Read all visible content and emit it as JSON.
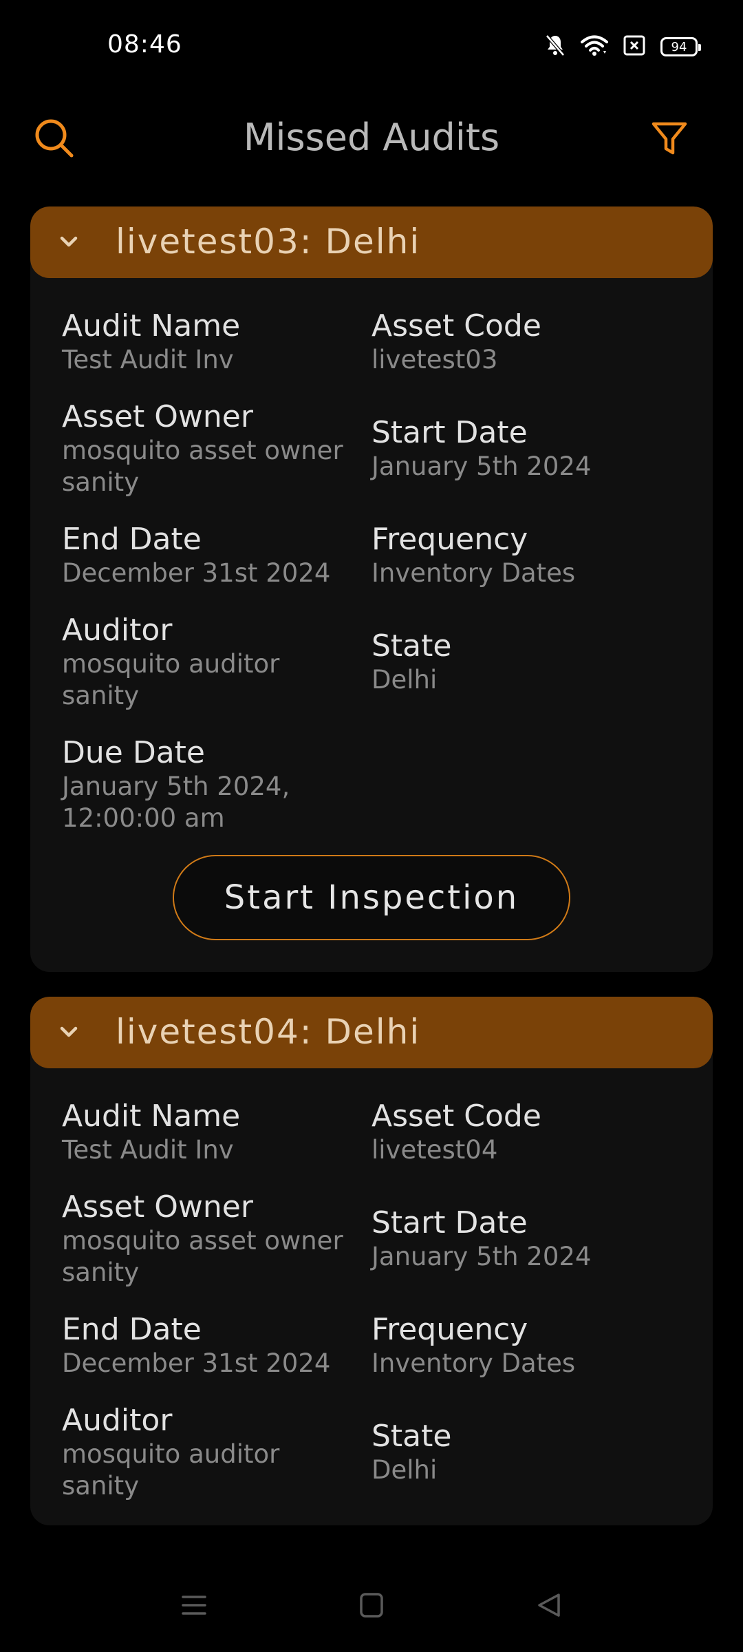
{
  "status_bar": {
    "time": "08:46",
    "battery": "94",
    "icons": [
      "bell-muted-icon",
      "wifi-icon",
      "sim-x-icon",
      "battery-icon"
    ]
  },
  "header": {
    "title": "Missed Audits",
    "icons": [
      "search-icon",
      "filter-icon"
    ],
    "accent_color": "#f08a1c"
  },
  "cards": [
    {
      "title": "livetest03: Delhi",
      "audit_name_label": "Audit Name",
      "audit_name": "Test Audit Inv",
      "asset_code_label": "Asset Code",
      "asset_code": "livetest03",
      "asset_owner_label": "Asset Owner",
      "asset_owner": "mosquito asset owner sanity",
      "start_date_label": "Start Date",
      "start_date": "January 5th 2024",
      "end_date_label": "End Date",
      "end_date": "December 31st 2024",
      "frequency_label": "Frequency",
      "frequency": "Inventory Dates",
      "auditor_label": "Auditor",
      "auditor": "mosquito auditor sanity",
      "state_label": "State",
      "state": "Delhi",
      "due_date_label": "Due Date",
      "due_date": "January 5th 2024, 12:00:00 am",
      "action_label": "Start Inspection"
    },
    {
      "title": "livetest04: Delhi",
      "audit_name_label": "Audit Name",
      "audit_name": "Test Audit Inv",
      "asset_code_label": "Asset Code",
      "asset_code": "livetest04",
      "asset_owner_label": "Asset Owner",
      "asset_owner": "mosquito asset owner sanity",
      "start_date_label": "Start Date",
      "start_date": "January 5th 2024",
      "end_date_label": "End Date",
      "end_date": "December 31st 2024",
      "frequency_label": "Frequency",
      "frequency": "Inventory Dates",
      "auditor_label": "Auditor",
      "auditor": "mosquito auditor sanity",
      "state_label": "State",
      "state": "Delhi"
    }
  ],
  "colors": {
    "card_header": "#7a4208",
    "card_body": "#101010",
    "button_border": "#d07a17"
  },
  "nav_bar": {
    "icons": [
      "menu-icon",
      "home-square-icon",
      "back-triangle-icon"
    ]
  }
}
